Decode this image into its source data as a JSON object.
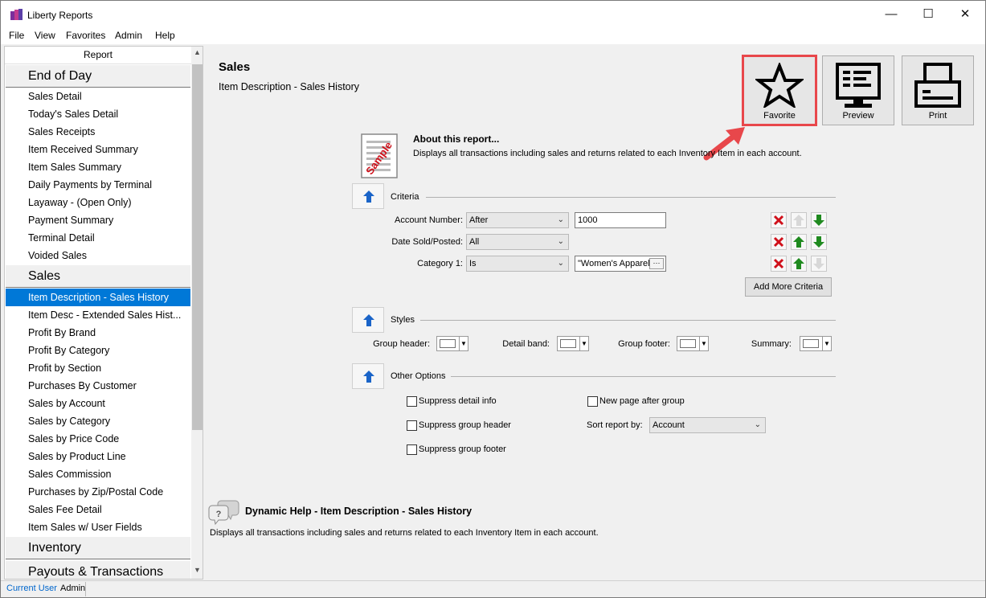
{
  "window": {
    "title": "Liberty Reports",
    "minimize_glyph": "—",
    "maximize_glyph": "☐",
    "close_glyph": "✕"
  },
  "menu": [
    "File",
    "View",
    "Favorites",
    "Admin",
    "Help"
  ],
  "sidebar": {
    "header": "Report",
    "groups": [
      {
        "label": "End of Day",
        "items": [
          "Sales Detail",
          "Today's Sales Detail",
          "Sales Receipts",
          "Item Received Summary",
          "Item Sales Summary",
          "Daily Payments by Terminal",
          "Layaway - (Open Only)",
          "Payment Summary",
          "Terminal Detail",
          "Voided Sales"
        ]
      },
      {
        "label": "Sales",
        "items": [
          "Item Description - Sales History",
          "Item Desc - Extended Sales Hist...",
          "Profit By Brand",
          "Profit By Category",
          "Profit by Section",
          "Purchases By Customer",
          "Sales by Account",
          "Sales by Category",
          "Sales by Price Code",
          "Sales by Product Line",
          "Sales Commission",
          "Purchases by Zip/Postal Code",
          "Sales Fee Detail",
          "Item Sales w/ User Fields"
        ]
      },
      {
        "label": "Inventory",
        "items": []
      },
      {
        "label": "Payouts & Transactions",
        "items": []
      }
    ],
    "selected": "Item Description - Sales History"
  },
  "main": {
    "title": "Sales",
    "subtitle": "Item Description - Sales History",
    "toolbar": {
      "favorite": "Favorite",
      "preview": "Preview",
      "print": "Print"
    },
    "about": {
      "title": "About this report...",
      "text": "Displays all transactions including sales and returns related to each Inventory Item in each account.",
      "icon_text": "Sample"
    },
    "criteria": {
      "label": "Criteria",
      "rows": [
        {
          "label": "Account Number:",
          "operator": "After",
          "value": "1000"
        },
        {
          "label": "Date Sold/Posted:",
          "operator": "All",
          "value": ""
        },
        {
          "label": "Category 1:",
          "operator": "Is",
          "value": "\"Women's Apparel"
        }
      ],
      "add_more": "Add More Criteria"
    },
    "styles": {
      "label": "Styles",
      "group_header": "Group header:",
      "detail_band": "Detail band:",
      "group_footer": "Group footer:",
      "summary": "Summary:"
    },
    "other": {
      "label": "Other Options",
      "suppress_detail": "Suppress detail info",
      "suppress_group_header": "Suppress group header",
      "suppress_group_footer": "Suppress group footer",
      "new_page": "New page after group",
      "sort_label": "Sort report by:",
      "sort_value": "Account"
    },
    "help": {
      "title": "Dynamic Help - Item Description - Sales History",
      "text": "Displays all transactions including sales and returns related to each Inventory Item in each account."
    }
  },
  "status": {
    "label": "Current User",
    "user": "Admin"
  },
  "colors": {
    "accent": "#0078d7",
    "highlight": "#e8474b",
    "up_arrow": "#1a64c8",
    "green_arrow": "#1f8a1f",
    "delete_x": "#d0101a"
  }
}
